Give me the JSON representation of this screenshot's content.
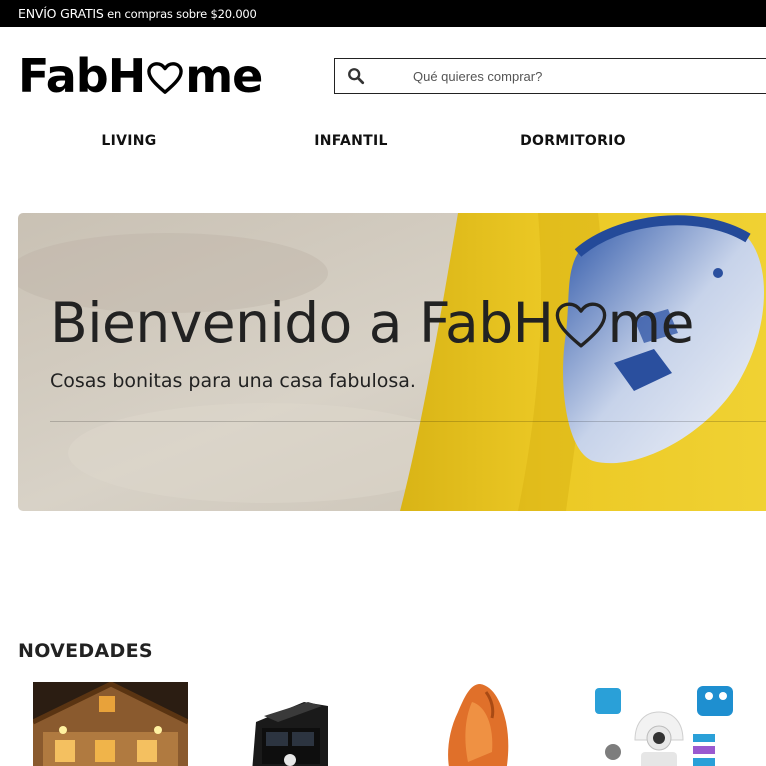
{
  "topbar": {
    "promo_strong": "ENVÍO GRATIS",
    "promo_rest": "en compras sobre $20.000",
    "background": "#000000",
    "text_color": "#ffffff"
  },
  "header": {
    "logo_prefix": "FabH",
    "logo_suffix": "me",
    "logo_icon": "heart-icon",
    "search": {
      "placeholder": "Qué quieres comprar?",
      "value": "",
      "icon": "search-icon"
    }
  },
  "nav": {
    "items": [
      {
        "label": "LIVING"
      },
      {
        "label": "INFANTIL"
      },
      {
        "label": "DORMITORIO"
      }
    ]
  },
  "hero": {
    "title_prefix": "Bienvenido a FabH",
    "title_suffix": "me",
    "subtitle": "Cosas bonitas para una casa fabulosa.",
    "accent": "#e8c51c"
  },
  "novedades": {
    "title": "NOVEDADES",
    "products": [
      {
        "name": "house-lights-image"
      },
      {
        "name": "solar-lamp-image"
      },
      {
        "name": "salt-lamp-image"
      },
      {
        "name": "ip-camera-image"
      }
    ]
  }
}
